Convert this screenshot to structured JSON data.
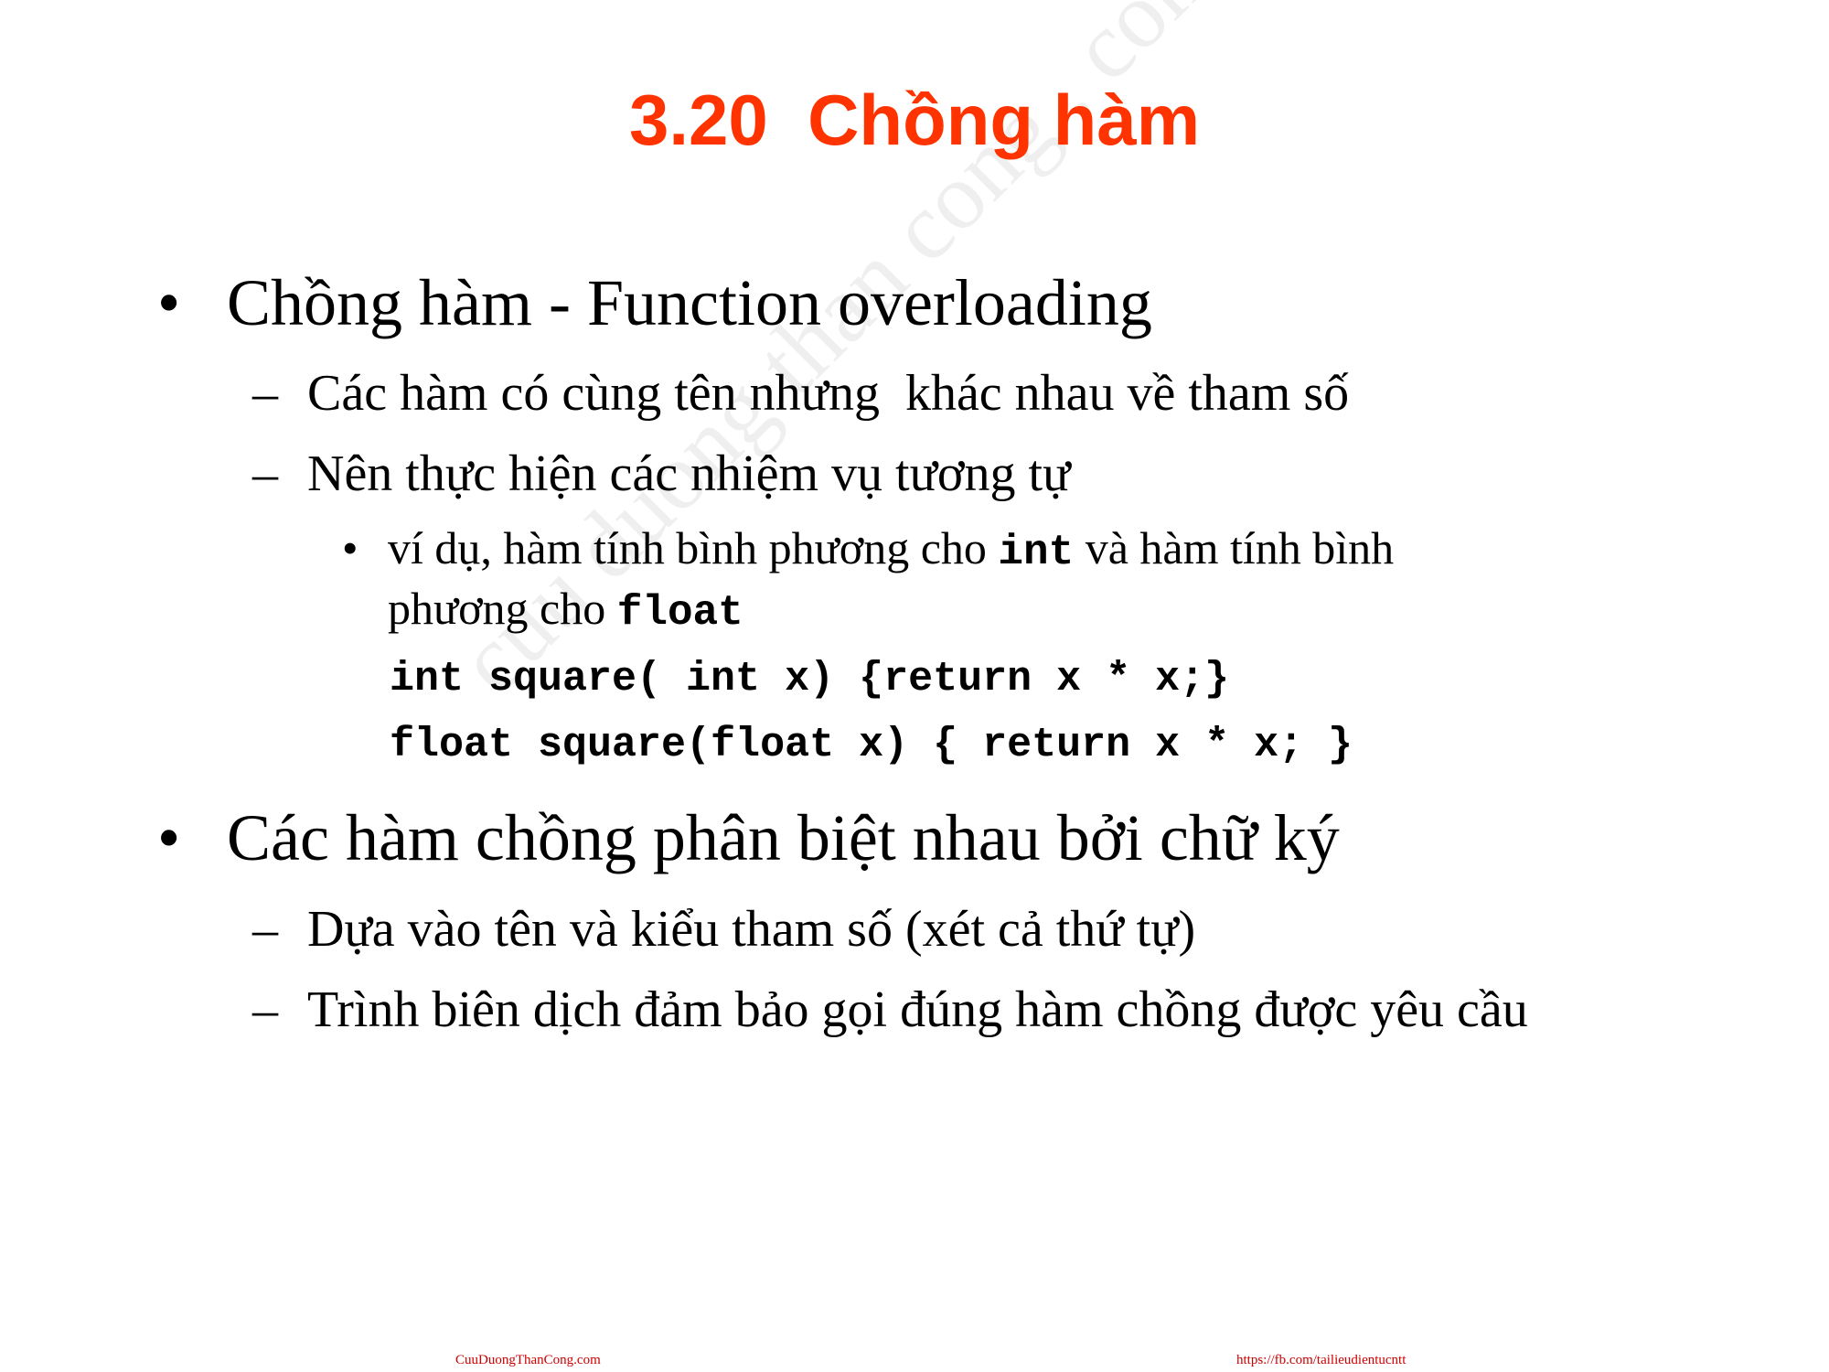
{
  "slide": {
    "title": "3.20  Chồng hàm",
    "watermark": "cuu duong than cong . com",
    "bullet_symbol": "•",
    "dash_symbol": "–",
    "item1": {
      "text": "Chồng hàm - Function overloading",
      "sub1": "Các hàm có cùng tên nhưng  khác nhau về tham số",
      "sub2": "Nên thực hiện các nhiệm vụ tương tự",
      "example": {
        "pre": "ví dụ, hàm tính bình phương cho ",
        "kw1": "int",
        "mid": " và hàm tính bình",
        "line2_pre": "phương cho ",
        "kw2": "float"
      },
      "code": [
        "int square( int x) {return x * x;}",
        "float square(float x) { return x * x; }"
      ]
    },
    "item2": {
      "text": "Các hàm chồng phân biệt nhau bởi chữ ký",
      "sub1": "Dựa vào tên và kiểu tham số (xét cả thứ tự)",
      "sub2": "Trình biên dịch đảm bảo gọi đúng hàm chồng được yêu cầu"
    },
    "footer": {
      "left": "CuuDuongThanCong.com",
      "right": "https://fb.com/tailieudientucntt"
    }
  }
}
